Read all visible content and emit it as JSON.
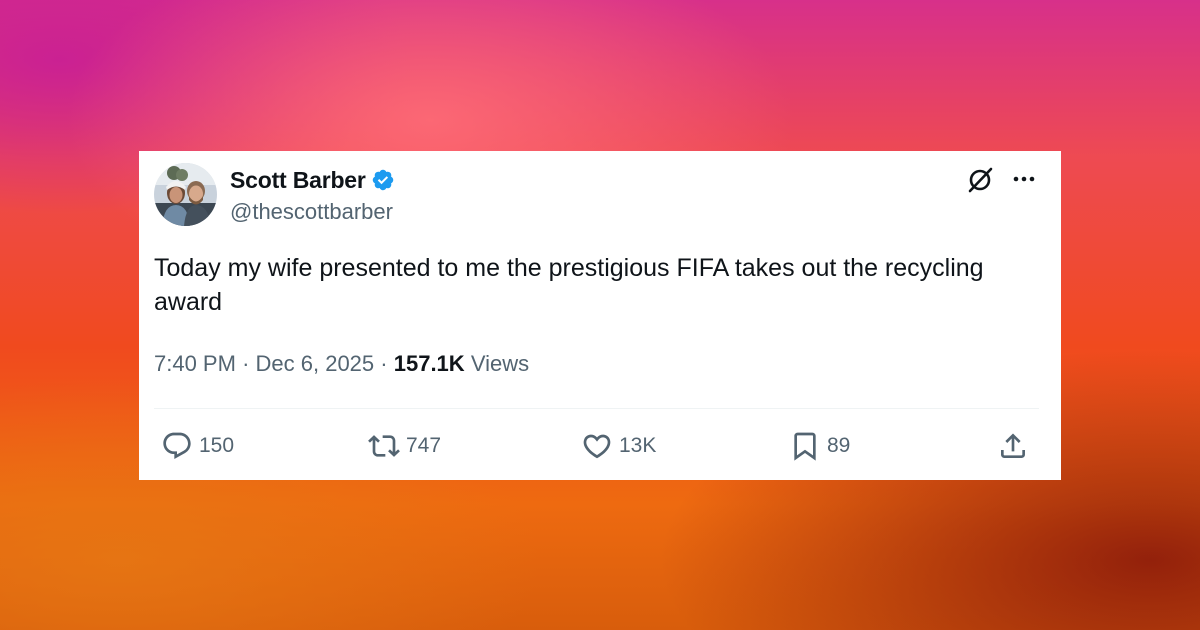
{
  "background": {
    "colors": [
      "#d7308a",
      "#ee4a52",
      "#f04a1e",
      "#ee6a10"
    ]
  },
  "tweet": {
    "author": {
      "name": "Scott Barber",
      "handle": "@thescottbarber",
      "verified": true,
      "verified_color": "#1d9bf0"
    },
    "text": "Today my wife presented to me the prestigious FIFA takes out the recycling award",
    "time": "7:40 PM",
    "date": "Dec 6, 2025",
    "separator": "·",
    "views_count": "157.1K",
    "views_label": "Views",
    "header_icons": [
      "grok-icon",
      "more-icon"
    ]
  },
  "actions": {
    "reply": {
      "icon": "reply-icon",
      "count": "150"
    },
    "retweet": {
      "icon": "retweet-icon",
      "count": "747"
    },
    "like": {
      "icon": "heart-icon",
      "count": "13K"
    },
    "bookmark": {
      "icon": "bookmark-icon",
      "count": "89"
    },
    "share": {
      "icon": "share-icon"
    }
  },
  "colors": {
    "text_primary": "#0f1419",
    "text_secondary": "#536471",
    "divider": "#eff3f4"
  }
}
